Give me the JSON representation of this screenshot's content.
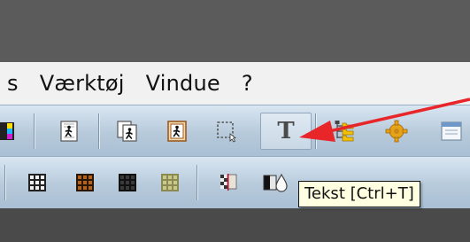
{
  "menubar": {
    "items": [
      "s",
      "Værktøj",
      "Vindue",
      "?"
    ]
  },
  "tooltip": {
    "text": "Tekst [Ctrl+T]"
  },
  "toolbar1": {
    "text_tool_glyph": "T"
  },
  "colors": {
    "title_bar": "#5b5b5b",
    "toolbar_gradient_top": "#d9e6f2",
    "toolbar_gradient_bottom": "#a9bfd3",
    "annotation_arrow": "#e8262a",
    "tooltip_bg": "#ffffe1"
  },
  "icons": {
    "toolbar1": [
      "color-swatch-icon",
      "runner-page-icon",
      "runner-copy-icon",
      "runner-frame-icon",
      "selection-rect-icon",
      "text-tool-icon",
      "tree-folder-icon",
      "gear-icon",
      "window-icon"
    ],
    "toolbar2": [
      "grid-icon",
      "brown-grid-icon",
      "dark-grid-icon",
      "olive-grid-icon",
      "transparency-icon",
      "contrast-icon",
      "drop-icon"
    ]
  }
}
